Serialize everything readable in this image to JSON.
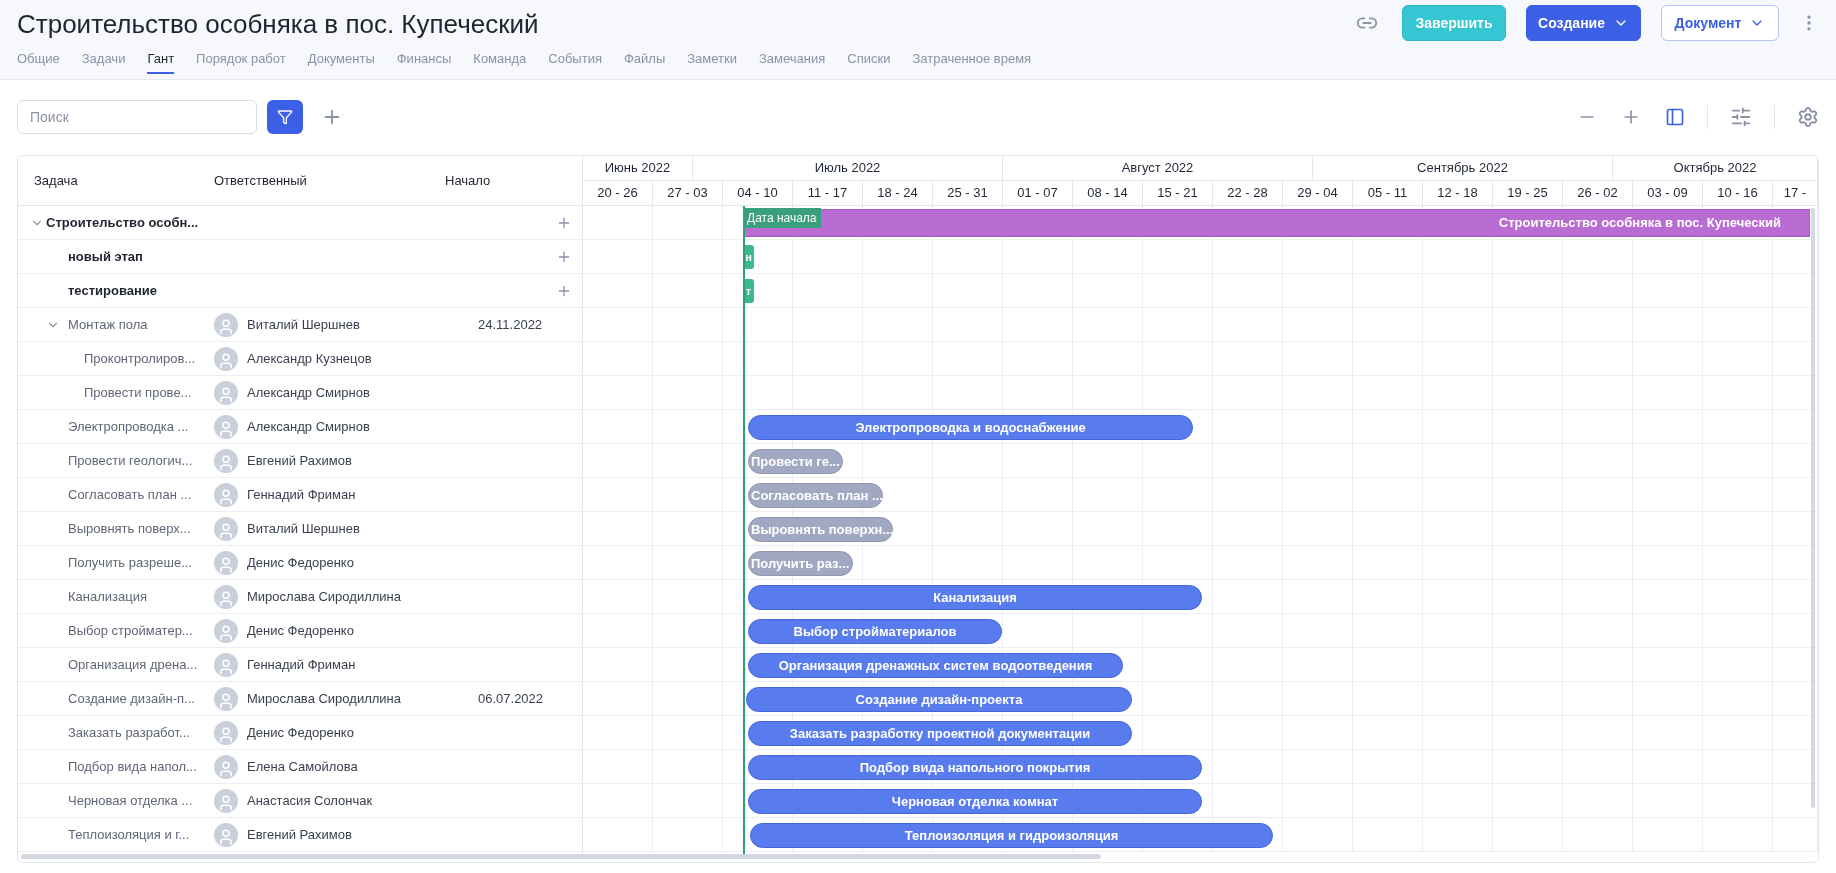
{
  "title": "Строительство особняка в пос. Купеческий",
  "tabs": [
    {
      "label": "Общие",
      "selected": false
    },
    {
      "label": "Задачи",
      "selected": false
    },
    {
      "label": "Гант",
      "selected": true
    },
    {
      "label": "Порядок работ",
      "selected": false
    },
    {
      "label": "Документы",
      "selected": false
    },
    {
      "label": "Финансы",
      "selected": false
    },
    {
      "label": "Команда",
      "selected": false
    },
    {
      "label": "События",
      "selected": false
    },
    {
      "label": "Файлы",
      "selected": false
    },
    {
      "label": "Заметки",
      "selected": false
    },
    {
      "label": "Замечания",
      "selected": false
    },
    {
      "label": "Списки",
      "selected": false
    },
    {
      "label": "Затраченное время",
      "selected": false
    }
  ],
  "actions": [
    {
      "label": "Завершить",
      "kind": "finish",
      "dropdown": false
    },
    {
      "label": "Создание",
      "kind": "primary",
      "dropdown": true
    },
    {
      "label": "Документ",
      "kind": "outline",
      "dropdown": true
    }
  ],
  "search": {
    "placeholder": "Поиск"
  },
  "table": {
    "columns": [
      "Задача",
      "Ответственный",
      "Начало"
    ],
    "rows": [
      {
        "task": "Строительство особн...",
        "kind": "project",
        "expanded": true,
        "bar": {
          "label": "Строительство особняка в пос. Купеческий",
          "kind": "phase"
        },
        "children": [
          {
            "task": "новый этап",
            "kind": "stage",
            "bar": {
              "label": "н",
              "kind": "stage"
            }
          },
          {
            "task": "тестирование",
            "kind": "stage",
            "bar": {
              "label": "т",
              "kind": "stage"
            }
          },
          {
            "task": "Монтаж пола",
            "kind": "task",
            "expanded": true,
            "assignee": "Виталий Шершнев",
            "start": "24.11.2022",
            "children": [
              {
                "task": "Проконтролиров...",
                "kind": "task",
                "assignee": "Александр Кузнецов"
              },
              {
                "task": "Провести прове...",
                "kind": "task",
                "assignee": "Александр Смирнов"
              }
            ]
          },
          {
            "task": "Электропроводка ...",
            "kind": "task",
            "assignee": "Александр Смирнов",
            "bar": {
              "label": "Электропроводка и водоснабжение",
              "kind": "active"
            }
          },
          {
            "task": "Провести геологич...",
            "kind": "task",
            "assignee": "Евгений Рахимов",
            "bar": {
              "label": "Провести ге...",
              "kind": "inactive"
            }
          },
          {
            "task": "Согласовать план ...",
            "kind": "task",
            "assignee": "Геннадий Фриман",
            "bar": {
              "label": "Согласовать план ...",
              "kind": "inactive"
            }
          },
          {
            "task": "Выровнять поверх...",
            "kind": "task",
            "assignee": "Виталий Шершнев",
            "bar": {
              "label": "Выровнять поверхн...",
              "kind": "inactive"
            }
          },
          {
            "task": "Получить разреше...",
            "kind": "task",
            "assignee": "Денис Федоренко",
            "bar": {
              "label": "Получить раз...",
              "kind": "inactive"
            }
          },
          {
            "task": "Канализация",
            "kind": "task",
            "assignee": "Мирослава Сиродиллина",
            "bar": {
              "label": "Канализация",
              "kind": "active"
            }
          },
          {
            "task": "Выбор стройматер...",
            "kind": "task",
            "assignee": "Денис Федоренко",
            "bar": {
              "label": "Выбор стройматериалов",
              "kind": "active"
            }
          },
          {
            "task": "Организация дрена...",
            "kind": "task",
            "assignee": "Геннадий Фриман",
            "bar": {
              "label": "Организация дренажных систем водоотведения",
              "kind": "active"
            }
          },
          {
            "task": "Создание дизайн-п...",
            "kind": "task",
            "assignee": "Мирослава Сиродиллина",
            "start": "06.07.2022",
            "bar": {
              "label": "Создание дизайн-проекта",
              "kind": "active"
            }
          },
          {
            "task": "Заказать разработ...",
            "kind": "task",
            "assignee": "Денис Федоренко",
            "bar": {
              "label": "Заказать разработку проектной документации",
              "kind": "active"
            }
          },
          {
            "task": "Подбор вида напол...",
            "kind": "task",
            "assignee": "Елена Самойлова",
            "bar": {
              "label": "Подбор вида напольного покрытия",
              "kind": "active"
            }
          },
          {
            "task": "Черновая отделка ...",
            "kind": "task",
            "assignee": "Анастасия Солончак",
            "bar": {
              "label": "Черновая отделка комнат",
              "kind": "active"
            }
          },
          {
            "task": "Теплоизоляция и г...",
            "kind": "task",
            "assignee": "Евгений Рахимов",
            "bar": {
              "label": "Теплоизоляция и гидроизоляция",
              "kind": "active"
            }
          }
        ]
      }
    ]
  },
  "timeline": {
    "months": [
      "Июнь 2022",
      "Июль 2022",
      "Август 2022",
      "Сентябрь 2022",
      "Октябрь 2022"
    ],
    "weeks": [
      "20 - 26",
      "27 - 03",
      "04 - 10",
      "11 - 17",
      "18 - 24",
      "25 - 31",
      "01 - 07",
      "08 - 14",
      "15 - 21",
      "22 - 28",
      "29 - 04",
      "05 - 11",
      "12 - 18",
      "19 - 25",
      "26 - 02",
      "03 - 09",
      "10 - 16",
      "17 -"
    ],
    "start_marker": "Дата начала"
  }
}
